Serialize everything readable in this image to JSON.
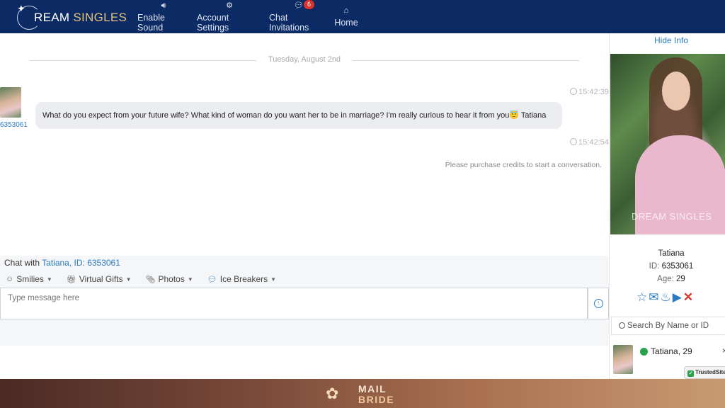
{
  "header": {
    "logo_text_1": "REAM",
    "logo_text_2": "SINGLES",
    "logo_letter": "D",
    "nav": [
      {
        "label": "Enable Sound",
        "icon": "sound-icon"
      },
      {
        "label": "Account Settings",
        "icon": "gears-icon"
      },
      {
        "label": "Chat Invitations",
        "icon": "chat-bubble-icon",
        "badge": "6"
      },
      {
        "label": "Home",
        "icon": "home-icon"
      }
    ]
  },
  "chat": {
    "date": "Tuesday, August 2nd",
    "messages": [
      {
        "sender_id": "6353061",
        "time": "15:42:39",
        "text": "What do you expect from your future wife? What kind of woman do you want her to be in marriage? I'm really curious to hear it from you😇 Tatiana"
      }
    ],
    "notice_time": "15:42:54",
    "notice": "Please purchase credits to start a conversation."
  },
  "composer": {
    "chat_with_prefix": "Chat with",
    "chat_with_link": "Tatiana, ID: 6353061",
    "tools": [
      {
        "label": "Smilies",
        "icon": "smiley-icon"
      },
      {
        "label": "Virtual Gifts",
        "icon": "gift-icon"
      },
      {
        "label": "Photos",
        "icon": "paperclip-icon"
      },
      {
        "label": "Ice Breakers",
        "icon": "speech-icon"
      }
    ],
    "placeholder": "Type message here"
  },
  "side": {
    "hide_info": "Hide Info",
    "photo_watermark": "DREAM SINGLES",
    "name": "Tatiana",
    "id_label": "ID:",
    "id_value": "6353061",
    "age_label": "Age:",
    "age_value": "29",
    "search_placeholder": "Search By Name or ID",
    "contact_name": "Tatiana, 29",
    "trusted": "TrustedSite"
  },
  "footer": {
    "brand_top": "MAIL",
    "brand_bottom": "BRIDE"
  },
  "colors": {
    "header_bg": "#0c2a63",
    "link": "#2a7bc0",
    "online": "#27a24a",
    "danger": "#d9342b"
  }
}
